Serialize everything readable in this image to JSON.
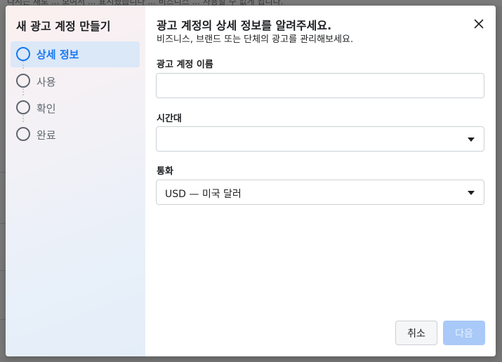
{
  "background": {
    "top_text": "다시는 새로 ... 보여서 ... 표시됐습니다 ... 비즈니스 ... 사용할 수 없게 됩니다."
  },
  "sidebar": {
    "title": "새 광고 계정 만들기",
    "steps": [
      {
        "label": "상세 정보",
        "active": true
      },
      {
        "label": "사용",
        "active": false
      },
      {
        "label": "확인",
        "active": false
      },
      {
        "label": "완료",
        "active": false
      }
    ]
  },
  "main": {
    "title": "광고 계정의 상세 정보를 알려주세요.",
    "subtitle": "비즈니스, 브랜드 또는 단체의 광고를 관리해보세요.",
    "fields": {
      "account_name": {
        "label": "광고 계정 이름",
        "value": ""
      },
      "timezone": {
        "label": "시간대",
        "value": ""
      },
      "currency": {
        "label": "통화",
        "value": "USD — 미국 달러"
      }
    },
    "buttons": {
      "cancel": "취소",
      "next": "다음"
    }
  },
  "colors": {
    "accent": "#1877f2",
    "active_step_bg": "#dbe8f8",
    "next_disabled": "#a9c9f8"
  }
}
